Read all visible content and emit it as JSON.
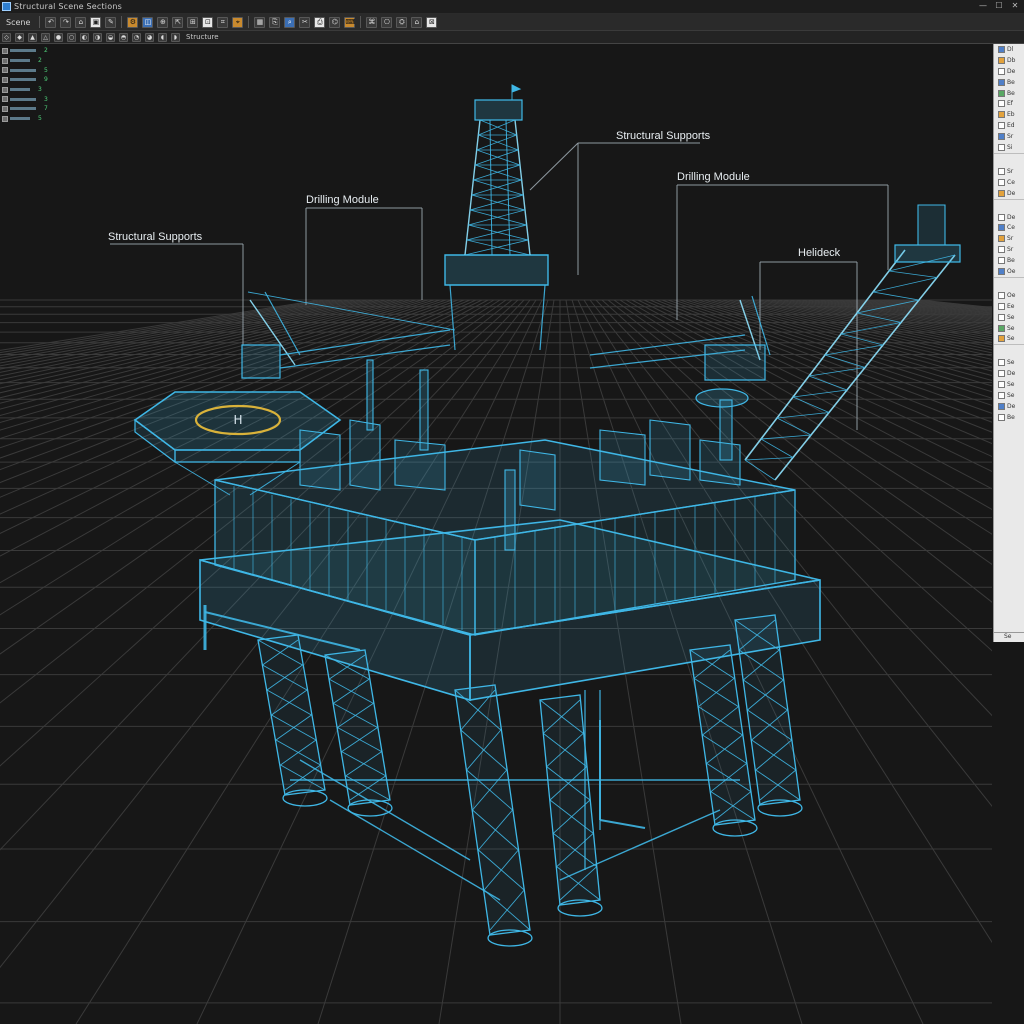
{
  "window": {
    "title": "Structural Scene Sections",
    "controls": [
      "—",
      "☐",
      "✕"
    ]
  },
  "toolbar1": {
    "label": "Scene",
    "buttons": [
      "↶",
      "↷",
      "⌂",
      "▣",
      "✎",
      "⚙",
      "◫",
      "⊕",
      "⇱",
      "⊞",
      "⊡",
      "⌗",
      "⌖",
      "▦",
      "⎘",
      "⌕",
      "✂",
      "⎙",
      "⌬",
      "⌨",
      "⌘",
      "⎔",
      "⛭",
      "⌂",
      "⊠"
    ]
  },
  "toolbar2": {
    "label": "Structure",
    "buttons": [
      "◇",
      "◆",
      "▲",
      "△",
      "●",
      "○",
      "◐",
      "◑",
      "◒",
      "◓",
      "◔",
      "◕",
      "◖",
      "◗"
    ]
  },
  "tree": {
    "items": [
      {
        "value": "2"
      },
      {
        "value": "2"
      },
      {
        "value": "5"
      },
      {
        "value": "9"
      },
      {
        "value": "3"
      },
      {
        "value": "3"
      },
      {
        "value": "7"
      },
      {
        "value": "5"
      }
    ]
  },
  "callouts": {
    "structural_supports_left": "Structural Supports",
    "drilling_module_left": "Drilling Module",
    "structural_supports_right": "Structural Supports",
    "drilling_module_right": "Drilling Module",
    "helideck": "Helideck"
  },
  "right_panel": {
    "rows": [
      {
        "icon": "b",
        "text": "Dl"
      },
      {
        "icon": "o",
        "text": "Db"
      },
      {
        "icon": "",
        "text": "De"
      },
      {
        "icon": "b",
        "text": "Be"
      },
      {
        "icon": "g",
        "text": "Be"
      },
      {
        "icon": "",
        "text": "Ef"
      },
      {
        "icon": "o",
        "text": "Eb"
      },
      {
        "icon": "",
        "text": "Ed"
      },
      {
        "icon": "b",
        "text": "Sr"
      },
      {
        "icon": "",
        "text": "Si"
      },
      {
        "icon": "",
        "text": "Sr"
      },
      {
        "icon": "",
        "text": "Ce"
      },
      {
        "icon": "o",
        "text": "De"
      },
      {
        "icon": "",
        "text": "De"
      },
      {
        "icon": "b",
        "text": "Ce"
      },
      {
        "icon": "o",
        "text": "Sr"
      },
      {
        "icon": "",
        "text": "Sr"
      },
      {
        "icon": "",
        "text": "Be"
      },
      {
        "icon": "b",
        "text": "Oe"
      },
      {
        "icon": "",
        "text": "Oe"
      },
      {
        "icon": "",
        "text": "Ee"
      },
      {
        "icon": "",
        "text": "Se"
      },
      {
        "icon": "g",
        "text": "Se"
      },
      {
        "icon": "o",
        "text": "Se"
      },
      {
        "icon": "",
        "text": "Se"
      },
      {
        "icon": "",
        "text": "De"
      },
      {
        "icon": "",
        "text": "Se"
      },
      {
        "icon": "",
        "text": "Se"
      },
      {
        "icon": "b",
        "text": "De"
      },
      {
        "icon": "",
        "text": "Be"
      }
    ],
    "footer": "Se"
  },
  "colors": {
    "wireframe": "#3fb7e6",
    "wireframe_bright": "#8fe3ff",
    "grid": "#3a3a3a",
    "helideck_ring": "#d9b23a",
    "background": "#171717"
  }
}
